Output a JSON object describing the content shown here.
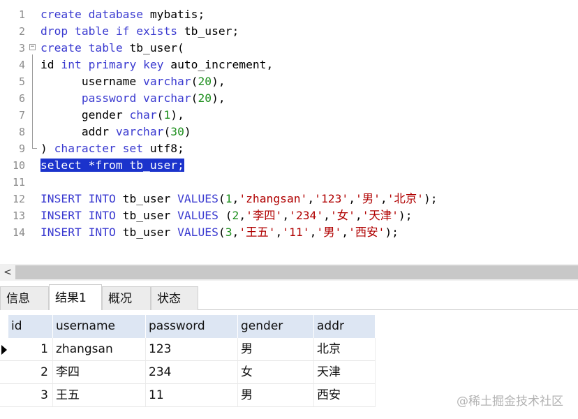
{
  "editor": {
    "lines": [
      {
        "n": "1",
        "tokens": [
          [
            "kw",
            "create database "
          ],
          [
            "",
            "mybatis;"
          ]
        ]
      },
      {
        "n": "2",
        "tokens": [
          [
            "kw",
            "drop table if exists "
          ],
          [
            "",
            "tb_user;"
          ]
        ]
      },
      {
        "n": "3",
        "tokens": [
          [
            "kw",
            "create table "
          ],
          [
            "",
            "tb_user("
          ]
        ]
      },
      {
        "n": "4",
        "tokens": [
          [
            "",
            "id "
          ],
          [
            "kw",
            "int primary key "
          ],
          [
            "",
            "auto_increment,"
          ]
        ]
      },
      {
        "n": "5",
        "tokens": [
          [
            "",
            "      username "
          ],
          [
            "kw",
            "varchar"
          ],
          [
            "",
            "("
          ],
          [
            "num",
            "20"
          ],
          [
            "",
            "),"
          ]
        ]
      },
      {
        "n": "6",
        "tokens": [
          [
            "",
            "      "
          ],
          [
            "kw",
            "password varchar"
          ],
          [
            "",
            "("
          ],
          [
            "num",
            "20"
          ],
          [
            "",
            "),"
          ]
        ]
      },
      {
        "n": "7",
        "tokens": [
          [
            "",
            "      gender "
          ],
          [
            "kw",
            "char"
          ],
          [
            "",
            "("
          ],
          [
            "num",
            "1"
          ],
          [
            "",
            "),"
          ]
        ]
      },
      {
        "n": "8",
        "tokens": [
          [
            "",
            "      addr "
          ],
          [
            "kw",
            "varchar"
          ],
          [
            "",
            "("
          ],
          [
            "num",
            "30"
          ],
          [
            "",
            ")"
          ]
        ]
      },
      {
        "n": "9",
        "tokens": [
          [
            "",
            ") "
          ],
          [
            "kw",
            "character set "
          ],
          [
            "",
            "utf8;"
          ]
        ]
      },
      {
        "n": "10",
        "tokens": [
          [
            "sel",
            "select *from tb_user;"
          ]
        ]
      },
      {
        "n": "11",
        "tokens": []
      },
      {
        "n": "12",
        "tokens": [
          [
            "kw",
            "INSERT INTO "
          ],
          [
            "",
            "tb_user "
          ],
          [
            "kw",
            "VALUES"
          ],
          [
            "",
            "("
          ],
          [
            "num",
            "1"
          ],
          [
            "",
            ","
          ],
          [
            "str",
            "'zhangsan'"
          ],
          [
            "",
            ","
          ],
          [
            "str",
            "'123'"
          ],
          [
            "",
            ","
          ],
          [
            "str",
            "'"
          ],
          [
            "strcjk",
            "男"
          ],
          [
            "str",
            "'"
          ],
          [
            "",
            ","
          ],
          [
            "str",
            "'"
          ],
          [
            "strcjk",
            "北京"
          ],
          [
            "str",
            "'"
          ],
          [
            "",
            ");"
          ]
        ]
      },
      {
        "n": "13",
        "tokens": [
          [
            "kw",
            "INSERT INTO "
          ],
          [
            "",
            "tb_user "
          ],
          [
            "kw",
            "VALUES "
          ],
          [
            "",
            "("
          ],
          [
            "num",
            "2"
          ],
          [
            "",
            ","
          ],
          [
            "str",
            "'"
          ],
          [
            "strcjk",
            "李四"
          ],
          [
            "str",
            "'"
          ],
          [
            "",
            ","
          ],
          [
            "str",
            "'234'"
          ],
          [
            "",
            ","
          ],
          [
            "str",
            "'"
          ],
          [
            "strcjk",
            "女"
          ],
          [
            "str",
            "'"
          ],
          [
            "",
            ","
          ],
          [
            "str",
            "'"
          ],
          [
            "strcjk",
            "天津"
          ],
          [
            "str",
            "'"
          ],
          [
            "",
            ");"
          ]
        ]
      },
      {
        "n": "14",
        "tokens": [
          [
            "kw",
            "INSERT INTO "
          ],
          [
            "",
            "tb_user "
          ],
          [
            "kw",
            "VALUES"
          ],
          [
            "",
            "("
          ],
          [
            "num",
            "3"
          ],
          [
            "",
            ","
          ],
          [
            "str",
            "'"
          ],
          [
            "strcjk",
            "王五"
          ],
          [
            "str",
            "'"
          ],
          [
            "",
            ","
          ],
          [
            "str",
            "'11'"
          ],
          [
            "",
            ","
          ],
          [
            "str",
            "'"
          ],
          [
            "strcjk",
            "男"
          ],
          [
            "str",
            "'"
          ],
          [
            "",
            ","
          ],
          [
            "str",
            "'"
          ],
          [
            "strcjk",
            "西安"
          ],
          [
            "str",
            "'"
          ],
          [
            "",
            ");"
          ]
        ]
      }
    ]
  },
  "scrollbar": {
    "left_arrow": "<"
  },
  "tabs": [
    {
      "label": "信息",
      "active": false
    },
    {
      "label": "结果1",
      "active": true
    },
    {
      "label": "概况",
      "active": false
    },
    {
      "label": "状态",
      "active": false
    }
  ],
  "results": {
    "columns": [
      "id",
      "username",
      "password",
      "gender",
      "addr"
    ],
    "rows": [
      [
        "1",
        "zhangsan",
        "123",
        "男",
        "北京"
      ],
      [
        "2",
        "李四",
        "234",
        "女",
        "天津"
      ],
      [
        "3",
        "王五",
        "11",
        "男",
        "西安"
      ]
    ],
    "current_row": 0
  },
  "watermark": "@稀土掘金技术社区",
  "colors": {
    "keyword": "#3a3ad0",
    "number": "#1e8f1e",
    "string": "#b00000",
    "selection": "#1b33cc",
    "header_bg": "#dde6f3"
  }
}
